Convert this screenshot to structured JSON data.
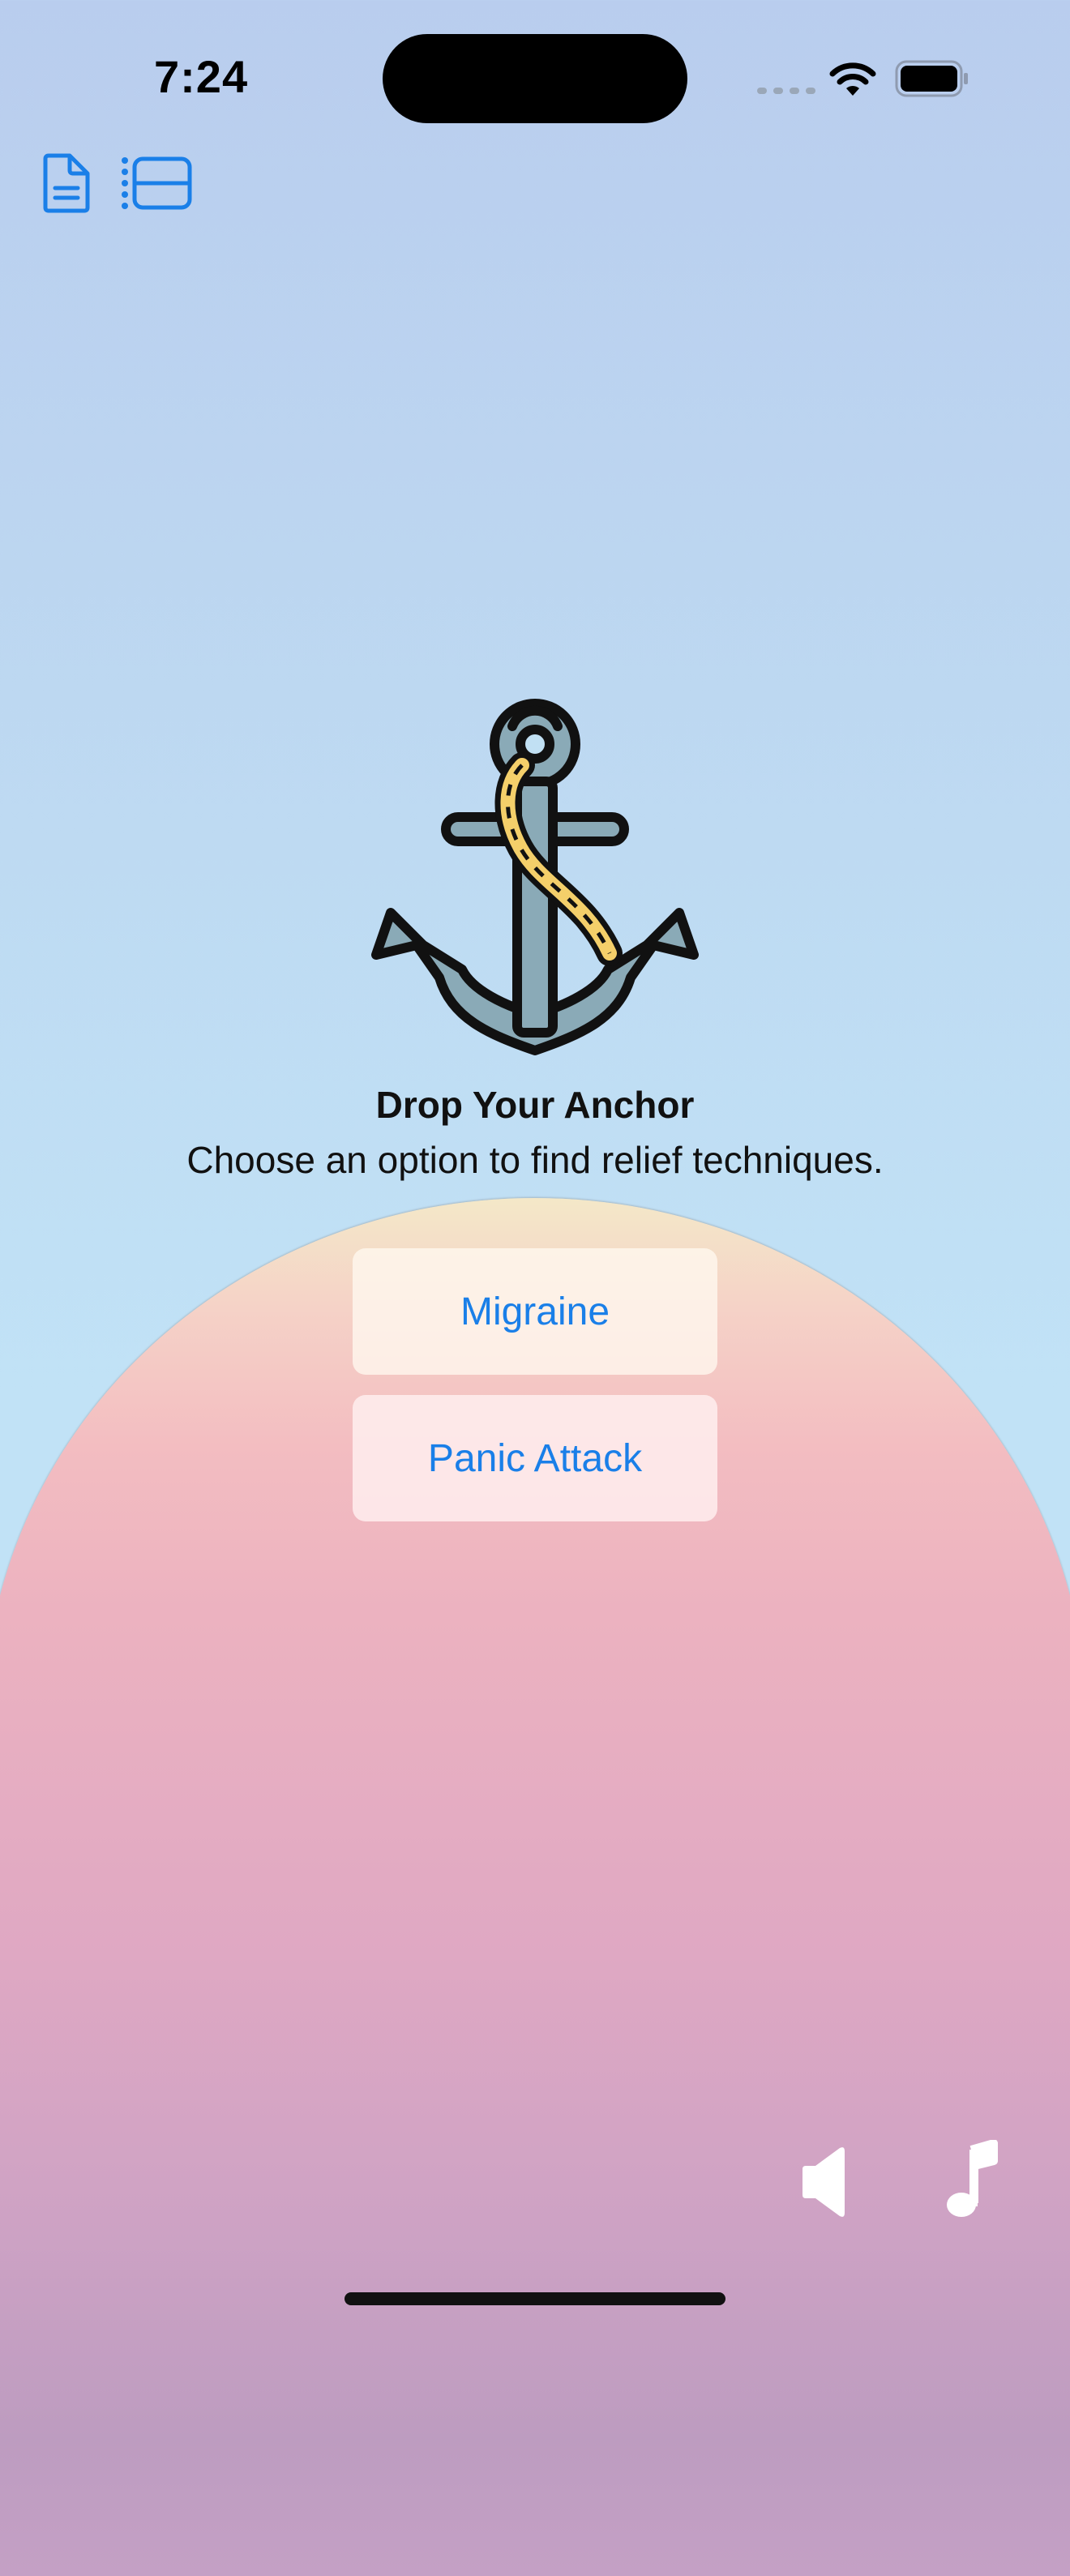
{
  "status_bar": {
    "time": "7:24"
  },
  "toolbar": {
    "left_icons": [
      "document-icon",
      "list-view-icon"
    ]
  },
  "main": {
    "title": "Drop Your Anchor",
    "subtitle": "Choose an option to find relief techniques.",
    "options": [
      {
        "label": "Migraine"
      },
      {
        "label": "Panic Attack"
      }
    ]
  },
  "bottom_controls": {
    "icons": [
      "speaker-icon",
      "music-note-icon"
    ]
  },
  "colors": {
    "accent": "#1a7fe8",
    "background_top": "#b9cdee",
    "background_mid": "#c1e2f6",
    "bump_top": "#f4e8c8",
    "bump_bottom": "#c4a0c5"
  }
}
